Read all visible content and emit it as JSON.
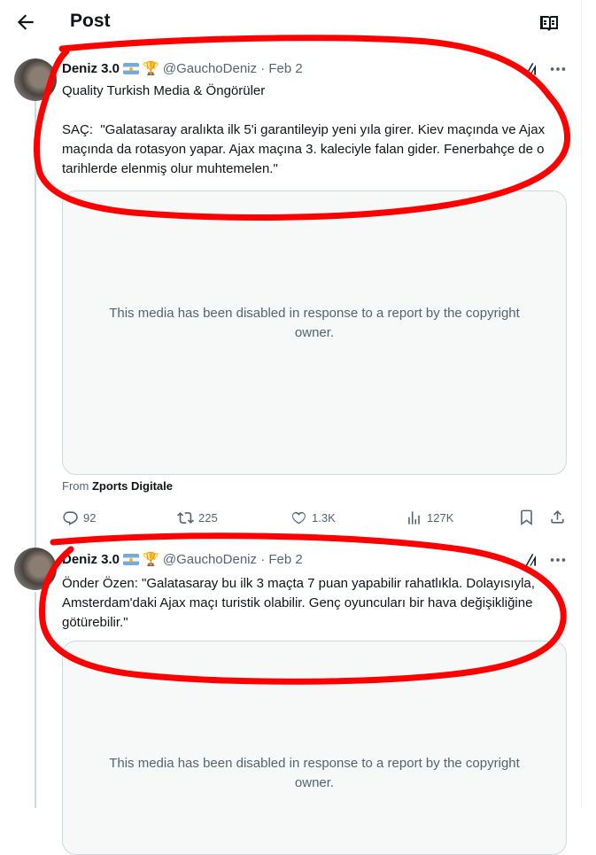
{
  "header": {
    "title": "Post"
  },
  "posts": [
    {
      "name": "Deniz 3.0",
      "handle": "@GauchoDeniz",
      "date": "· Feb 2",
      "text": "Quality Turkish Media & Öngörüler\n\nSAÇ:  \"Galatasaray aralıkta ilk 5'i garantileyip yeni yıla girer. Kiev maçında ve Ajax maçında da rotasyon yapar. Ajax maçına 3. kaleciyle falan gider. Fenerbahçe de o tarihlerde elenmiş olur muhtemelen.\"",
      "media_message": "This media has been disabled in response to a report by the copyright owner.",
      "from_label": "From",
      "from_source": "Zports Digitale",
      "replies": "92",
      "reposts": "225",
      "likes": "1.3K",
      "views": "127K"
    },
    {
      "name": "Deniz 3.0",
      "handle": "@GauchoDeniz",
      "date": "· Feb 2",
      "text": "Önder Özen: \"Galatasaray bu ilk 3 maçta 7 puan yapabilir rahatlıkla. Dolayısıyla, Amsterdam'daki Ajax maçı turistik olabilir. Genç oyuncuları bir hava değişikliğine götürebilir.\"",
      "media_message": "This media has been disabled in response to a report by the copyright owner."
    }
  ],
  "colors": {
    "text": "#0f1419",
    "secondary": "#536471",
    "border": "#cfd9de",
    "annotation": "#ff0000"
  }
}
